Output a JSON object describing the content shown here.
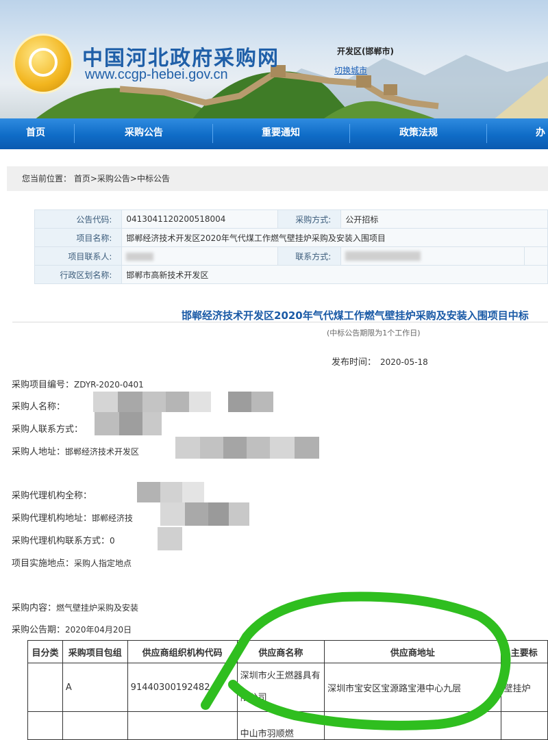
{
  "header": {
    "site_title": "中国河北政府采购网",
    "site_url": "www.ccgp-hebei.gov.cn",
    "region": "开发区(邯郸市)",
    "switch_city": "切换城市"
  },
  "nav": {
    "items": [
      "首页",
      "采购公告",
      "重要通知",
      "政策法规",
      "办"
    ]
  },
  "breadcrumb": {
    "label": "您当前位置：",
    "path": "首页>采购公告>中标公告"
  },
  "info_table": {
    "notice_code_label": "公告代码:",
    "notice_code": "0413041120200518004",
    "method_label": "采购方式:",
    "method": "公开招标",
    "project_name_label": "项目名称:",
    "project_name": "邯郸经济技术开发区2020年气代煤工作燃气壁挂炉采购及安装入围项目",
    "contact_label": "项目联系人:",
    "contact_method_label": "联系方式:",
    "district_label": "行政区划名称:",
    "district": "邯郸市高新技术开发区"
  },
  "notice": {
    "title": "邯郸经济技术开发区2020年气代煤工作燃气壁挂炉采购及安装入围项目中标",
    "subtitle": "(中标公告期限为1个工作日)",
    "pub_label": "发布时间：",
    "pub_date": "2020-05-18",
    "project_no_label": "采购项目编号：",
    "project_no": "ZDYR-2020-0401",
    "buyer_name_label": "采购人名称：",
    "buyer_contact_label": "采购人联系方式：",
    "buyer_address_label": "采购人地址：",
    "buyer_address_visible": "邯郸经济技术开发区",
    "agent_name_label": "采购代理机构全称：",
    "agent_address_label": "采购代理机构地址：",
    "agent_address_visible": "邯郸经济技",
    "agent_contact_label": "采购代理机构联系方式：",
    "agent_contact_visible": "0",
    "site_label": "项目实施地点：",
    "site": "采购人指定地点",
    "content_label": "采购内容：",
    "content": "燃气壁挂炉采购及安装",
    "period_label": "采购公告期：",
    "period": "2020年04月20日"
  },
  "winner_table": {
    "headers": [
      "目分类",
      "采购项目包组",
      "供应商组织机构代码",
      "供应商名称",
      "供应商地址",
      "主要标"
    ],
    "rows": [
      [
        "",
        "A",
        "91440300192482",
        "深圳市火王燃器具有限公司",
        "深圳市宝安区宝源路宝港中心九层",
        "壁挂炉"
      ],
      [
        "",
        "",
        "",
        "中山市羽顺燃",
        "",
        ""
      ]
    ]
  },
  "colors": {
    "nav_blue": "#0f6cc7",
    "title_blue": "#1a5aa6",
    "highlight_green": "#2fbe1f",
    "label_bg": "#eaf2f8"
  }
}
